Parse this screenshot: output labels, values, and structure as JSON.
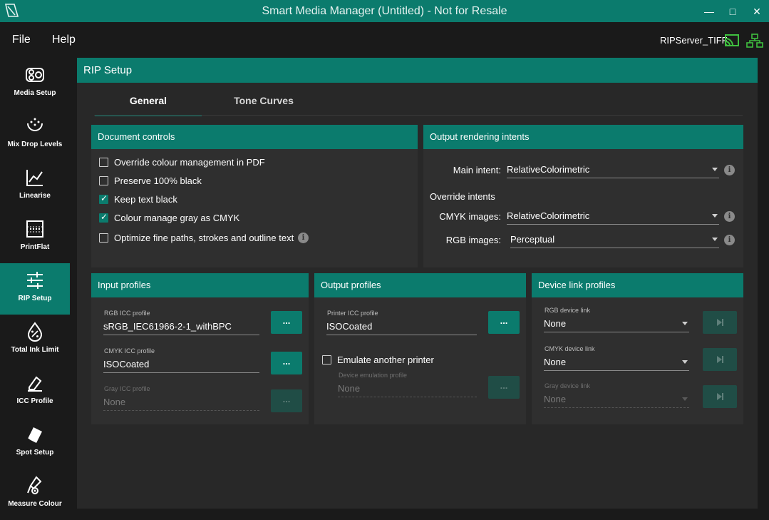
{
  "window": {
    "title": "Smart Media Manager (Untitled) - Not for Resale",
    "minimize": "—",
    "maximize": "□",
    "close": "✕"
  },
  "menu": {
    "file": "File",
    "help": "Help"
  },
  "server": {
    "name": "RIPServer_TIFF"
  },
  "sidebar": {
    "items": [
      {
        "label": "Media Setup",
        "icon": "media-setup-icon"
      },
      {
        "label": "Mix Drop Levels",
        "icon": "drop-levels-icon"
      },
      {
        "label": "Linearise",
        "icon": "linearise-icon"
      },
      {
        "label": "PrintFlat",
        "icon": "printflat-icon"
      },
      {
        "label": "RIP Setup",
        "icon": "rip-setup-icon",
        "active": true
      },
      {
        "label": "Total Ink Limit",
        "icon": "ink-limit-icon"
      },
      {
        "label": "ICC Profile",
        "icon": "icc-profile-icon"
      },
      {
        "label": "Spot Setup",
        "icon": "spot-setup-icon"
      },
      {
        "label": "Measure Colour",
        "icon": "measure-colour-icon"
      }
    ]
  },
  "page": {
    "title": "RIP Setup"
  },
  "tabs": {
    "general": "General",
    "tone_curves": "Tone Curves"
  },
  "document_controls": {
    "title": "Document controls",
    "options": [
      {
        "label": "Override colour management in PDF",
        "checked": false
      },
      {
        "label": "Preserve 100% black",
        "checked": false
      },
      {
        "label": "Keep text black",
        "checked": true
      },
      {
        "label": "Colour manage gray as CMYK",
        "checked": true
      },
      {
        "label": "Optimize fine paths, strokes and outline text",
        "checked": false,
        "info": "i"
      }
    ]
  },
  "output_intents": {
    "title": "Output rendering intents",
    "main_label": "Main intent:",
    "main_value": "RelativeColorimetric",
    "override_label": "Override intents",
    "cmyk_label": "CMYK images:",
    "cmyk_value": "RelativeColorimetric",
    "rgb_label": "RGB images:",
    "rgb_value": "Perceptual",
    "info": "i"
  },
  "input_profiles": {
    "title": "Input profiles",
    "rgb_label": "RGB ICC profile",
    "rgb_value": "sRGB_IEC61966-2-1_withBPC",
    "cmyk_label": "CMYK ICC profile",
    "cmyk_value": "ISOCoated",
    "gray_label": "Gray ICC profile",
    "gray_value": "None",
    "browse": "..."
  },
  "output_profiles": {
    "title": "Output profiles",
    "printer_label": "Printer ICC profile",
    "printer_value": "ISOCoated",
    "emulate_label": "Emulate another printer",
    "emulate_checked": false,
    "device_emu_label": "Device emulation profile",
    "device_emu_value": "None",
    "browse": "..."
  },
  "device_link": {
    "title": "Device link profiles",
    "rgb_label": "RGB device link",
    "rgb_value": "None",
    "cmyk_label": "CMYK device link",
    "cmyk_value": "None",
    "gray_label": "Gray device link",
    "gray_value": "None"
  },
  "colors": {
    "accent": "#0b7b6d",
    "background": "#1a1a1a",
    "panel": "#2f2f2f",
    "server_green": "#3fbf3f"
  }
}
